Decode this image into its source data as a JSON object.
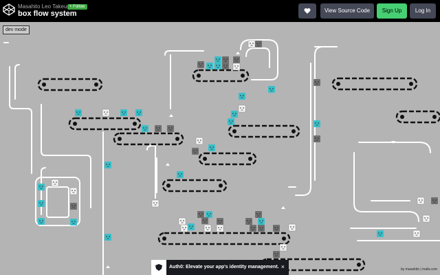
{
  "header": {
    "author": "Masahito Leo Takeuchi",
    "follow_label": "+ Follow",
    "title": "box flow system",
    "heart_icon": "heart-icon",
    "view_source_label": "View Source Code",
    "signup_label": "Sign Up",
    "login_label": "Log In"
  },
  "stage": {
    "dev_mode_label": "dev mode",
    "background_color": "#b4b4b4",
    "box_colors": {
      "cyan": "#3bbfc9",
      "white": "#f4f4f4",
      "gray": "#6f6f6f"
    }
  },
  "banner": {
    "text": "Auth0: Elevate your app's identity management.",
    "close": "×"
  },
  "credit": "by masahito | mafa.com"
}
